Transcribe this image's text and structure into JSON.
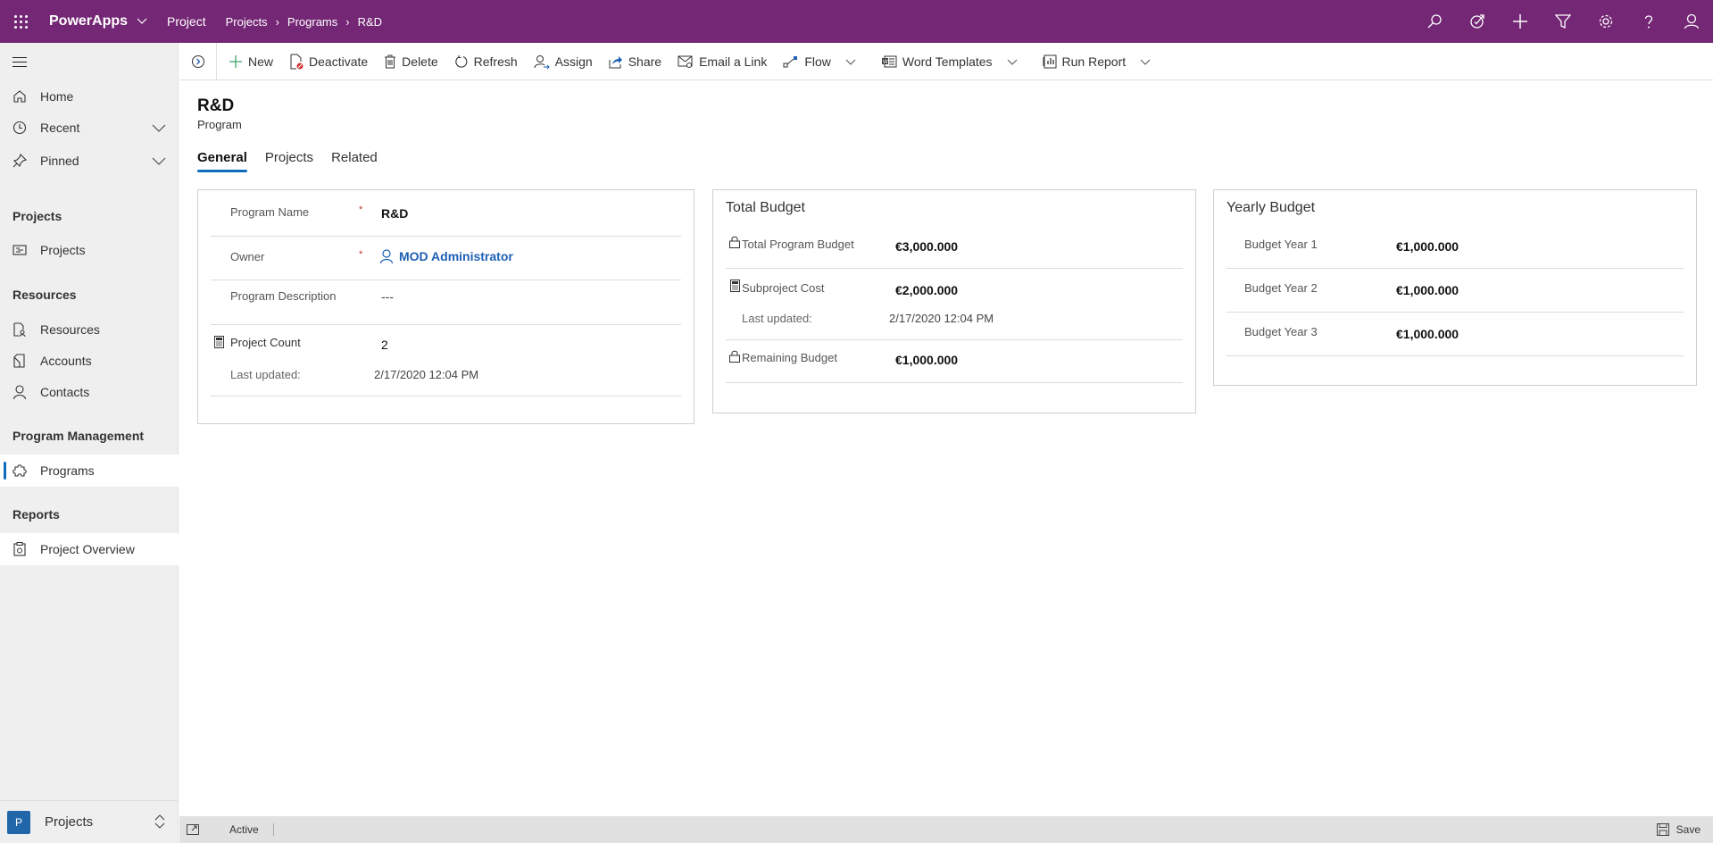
{
  "topbar": {
    "app_name": "PowerApps",
    "area": "Project",
    "breadcrumb": [
      "Projects",
      "Programs",
      "R&D"
    ],
    "icons": [
      "search-icon",
      "assistant-icon",
      "add-icon",
      "filter-icon",
      "settings-icon",
      "help-icon",
      "user-icon"
    ]
  },
  "sidebar": {
    "top_items": [
      {
        "label": "Home",
        "icon": "home-icon"
      },
      {
        "label": "Recent",
        "icon": "clock-icon"
      },
      {
        "label": "Pinned",
        "icon": "pin-icon"
      }
    ],
    "groups": [
      {
        "title": "Projects",
        "items": [
          {
            "label": "Projects",
            "icon": "projects-icon"
          }
        ]
      },
      {
        "title": "Resources",
        "items": [
          {
            "label": "Resources",
            "icon": "resources-icon"
          },
          {
            "label": "Accounts",
            "icon": "accounts-icon"
          },
          {
            "label": "Contacts",
            "icon": "contacts-icon"
          }
        ]
      },
      {
        "title": "Program Management",
        "items": [
          {
            "label": "Programs",
            "icon": "puzzle-icon",
            "selected": true
          }
        ]
      },
      {
        "title": "Reports",
        "items": [
          {
            "label": "Project Overview",
            "icon": "report-icon"
          }
        ]
      }
    ],
    "area_switcher": {
      "badge": "P",
      "label": "Projects"
    }
  },
  "commandbar": {
    "items": [
      {
        "label": "New",
        "icon": "plus-icon"
      },
      {
        "label": "Deactivate",
        "icon": "deactivate-icon"
      },
      {
        "label": "Delete",
        "icon": "trash-icon"
      },
      {
        "label": "Refresh",
        "icon": "refresh-icon"
      },
      {
        "label": "Assign",
        "icon": "assign-icon"
      },
      {
        "label": "Share",
        "icon": "share-icon"
      },
      {
        "label": "Email a Link",
        "icon": "email-icon"
      },
      {
        "label": "Flow",
        "icon": "flow-icon",
        "dropdown": true
      },
      {
        "label": "Word Templates",
        "icon": "word-icon",
        "dropdown": true
      },
      {
        "label": "Run Report",
        "icon": "report-icon",
        "dropdown": true
      }
    ]
  },
  "record": {
    "title": "R&D",
    "entity": "Program",
    "tabs": [
      {
        "label": "General",
        "active": true
      },
      {
        "label": "Projects",
        "active": false
      },
      {
        "label": "Related",
        "active": false
      }
    ]
  },
  "general": {
    "program_name_label": "Program Name",
    "program_name": "R&D",
    "owner_label": "Owner",
    "owner": "MOD Administrator",
    "description_label": "Program Description",
    "description": "---",
    "project_count_label": "Project Count",
    "project_count": "2",
    "last_updated_label": "Last updated:",
    "last_updated": "2/17/2020 12:04 PM"
  },
  "total_budget": {
    "title": "Total Budget",
    "total_label": "Total Program Budget",
    "total": "€3,000.000",
    "subproject_label": "Subproject Cost",
    "subproject": "€2,000.000",
    "last_updated_label": "Last updated:",
    "last_updated": "2/17/2020 12:04 PM",
    "remaining_label": "Remaining Budget",
    "remaining": "€1,000.000"
  },
  "yearly_budget": {
    "title": "Yearly Budget",
    "rows": [
      {
        "label": "Budget Year 1",
        "value": "€1,000.000"
      },
      {
        "label": "Budget Year 2",
        "value": "€1,000.000"
      },
      {
        "label": "Budget Year 3",
        "value": "€1,000.000"
      }
    ]
  },
  "statusbar": {
    "status": "Active",
    "save_label": "Save"
  },
  "colors": {
    "brand": "#742774",
    "accent": "#0f6cbd",
    "link": "#1e5fb5",
    "required": "#c0392b"
  }
}
